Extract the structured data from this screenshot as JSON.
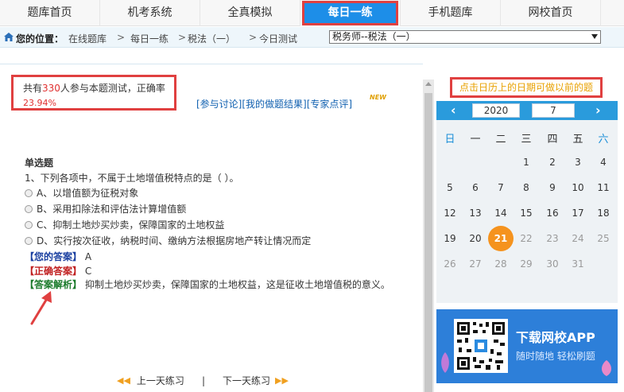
{
  "topnav": {
    "tabs": [
      "题库首页",
      "机考系统",
      "全真模拟",
      "每日一练",
      "手机题库",
      "网校首页"
    ],
    "active_index": 3
  },
  "breadcrumb": {
    "label": "您的位置：",
    "items": [
      "在线题库",
      "每日一练",
      "税法（一）",
      "今日测试"
    ],
    "separator": ">",
    "select_value": "税务师--税法（一）"
  },
  "stats": {
    "prefix": "共有",
    "count": "330",
    "middle": "人参与本题测试，正确率",
    "rate": "23.94%"
  },
  "links": [
    "[参与讨论]",
    "[我的做题结果]",
    "[专家点评]"
  ],
  "new_badge": "NEW",
  "question": {
    "type": "单选题",
    "text": "1、下列各项中，不属于土地增值税特点的是（  ）。",
    "options": [
      "A、以增值额为征税对象",
      "B、采用扣除法和评估法计算增值额",
      "C、抑制土地炒买炒卖，保障国家的土地权益",
      "D、实行按次征收，纳税时间、缴纳方法根据房地产转让情况而定"
    ],
    "your_answer_label": "【您的答案】",
    "your_answer": "A",
    "correct_answer_label": "【正确答案】",
    "correct_answer": "C",
    "analysis_label": "【答案解析】",
    "analysis": "抑制土地炒买炒卖，保障国家的土地权益，这是征收土地增值税的意义。"
  },
  "pager": {
    "prev": "上一天练习",
    "divider": "|",
    "next": "下一天练习"
  },
  "calendar": {
    "note": "点击日历上的日期可做以前的题",
    "year": "2020",
    "month": "7",
    "weekdays": [
      "日",
      "一",
      "二",
      "三",
      "四",
      "五",
      "六"
    ],
    "days": [
      "1",
      "2",
      "3",
      "4",
      "5",
      "6",
      "7",
      "8",
      "9",
      "10",
      "11",
      "12",
      "13",
      "14",
      "15",
      "16",
      "17",
      "18",
      "19",
      "20",
      "21",
      "22",
      "23",
      "24",
      "25",
      "26",
      "27",
      "28",
      "29",
      "30",
      "31"
    ],
    "first_weekday": 3,
    "today": "21",
    "prev_icon": "chevron-left-icon",
    "next_icon": "chevron-right-icon"
  },
  "promo": {
    "title": "下载网校APP",
    "subtitle": "随时随地 轻松刷题"
  },
  "colors": {
    "nav_active": "#1d8ee8",
    "highlight_border": "#e04040",
    "calendar_header": "#2a9bdc",
    "today_circle": "#f5931e",
    "promo_bg": "#2d7fd9"
  }
}
